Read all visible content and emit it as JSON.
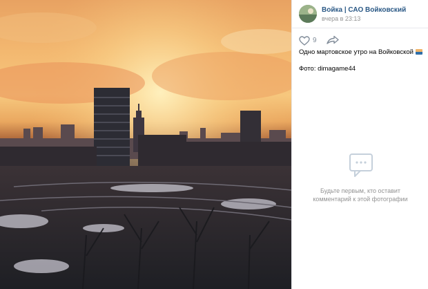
{
  "post": {
    "author": "Войка | САО Войковский",
    "time": "вчера в 23:13",
    "likes": "9",
    "caption": "Одно мартовское утро на Войковской",
    "credit": "Фото: dimagame44"
  },
  "comments": {
    "empty_line1": "Будьте первым, кто оставит",
    "empty_line2": "комментарий к этой фотографии"
  },
  "icons": {
    "like": "heart-icon",
    "share": "share-arrow-icon",
    "caption_emoji": "city-sunset-emoji-icon",
    "empty_comments": "comment-bubble-icon"
  },
  "colors": {
    "link": "#2a5885",
    "muted": "#939393",
    "icon": "#818c99"
  }
}
